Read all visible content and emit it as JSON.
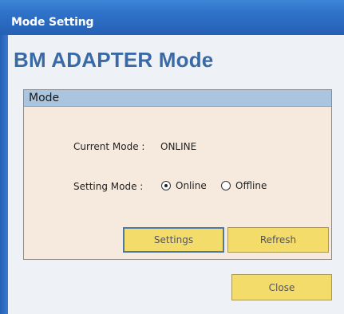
{
  "window": {
    "title": "Mode Setting"
  },
  "heading": "BM ADAPTER Mode",
  "mode_group": {
    "title": "Mode",
    "current_mode_label": "Current Mode :",
    "current_mode_value": "ONLINE",
    "setting_mode_label": "Setting Mode :",
    "options": [
      {
        "label": "Online",
        "checked": true
      },
      {
        "label": "Offline",
        "checked": false
      }
    ],
    "settings_button": "Settings",
    "refresh_button": "Refresh"
  },
  "close_button": "Close",
  "colors": {
    "titlebar": "#2f73c9",
    "heading": "#3a6aa6",
    "group_background": "#f5eadd",
    "group_header": "#a9c5df",
    "button": "#f4dc6a"
  }
}
